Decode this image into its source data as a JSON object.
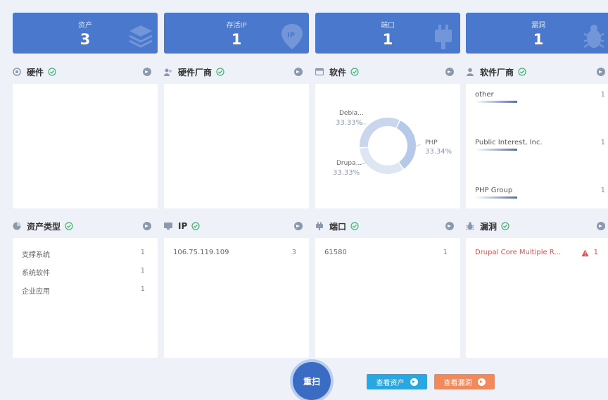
{
  "stats": [
    {
      "label": "资产",
      "value": "3"
    },
    {
      "label": "存活IP",
      "value": "1"
    },
    {
      "label": "端口",
      "value": "1"
    },
    {
      "label": "漏洞",
      "value": "1"
    }
  ],
  "panels": {
    "hardware": {
      "title": "硬件"
    },
    "hardware_vendor": {
      "title": "硬件厂商"
    },
    "software": {
      "title": "软件",
      "slices": [
        {
          "label": "Debia...",
          "pct": "33.33%",
          "value": 33.33
        },
        {
          "label": "PHP",
          "pct": "33.34%",
          "value": 33.34
        },
        {
          "label": "Drupa...",
          "pct": "33.33%",
          "value": 33.33
        }
      ]
    },
    "software_vendor": {
      "title": "软件厂商",
      "items": [
        {
          "label": "other",
          "count": "1"
        },
        {
          "label": "Public Interest, Inc.",
          "count": "1"
        },
        {
          "label": "PHP Group",
          "count": "1"
        }
      ]
    },
    "asset_type": {
      "title": "资产类型",
      "items": [
        {
          "label": "支撑系统",
          "count": "1"
        },
        {
          "label": "系统软件",
          "count": "1"
        },
        {
          "label": "企业应用",
          "count": "1"
        }
      ]
    },
    "ip": {
      "title": "IP",
      "items": [
        {
          "label": "106.75.119.109",
          "count": "3"
        }
      ]
    },
    "port": {
      "title": "端口",
      "items": [
        {
          "label": "61580",
          "count": "1"
        }
      ]
    },
    "vuln": {
      "title": "漏洞",
      "items": [
        {
          "label": "Drupal Core Multiple R...",
          "count": "1"
        }
      ]
    }
  },
  "actions": {
    "rescan": "重扫",
    "view_assets": "查看资产",
    "view_vulns": "查看漏洞"
  },
  "colors": {
    "stat_bg": "#4a78cc",
    "check": "#3cb371",
    "vuln_text": "#d9534f",
    "btn_assets": "#2aa7e1",
    "btn_vulns": "#f08a5d"
  }
}
